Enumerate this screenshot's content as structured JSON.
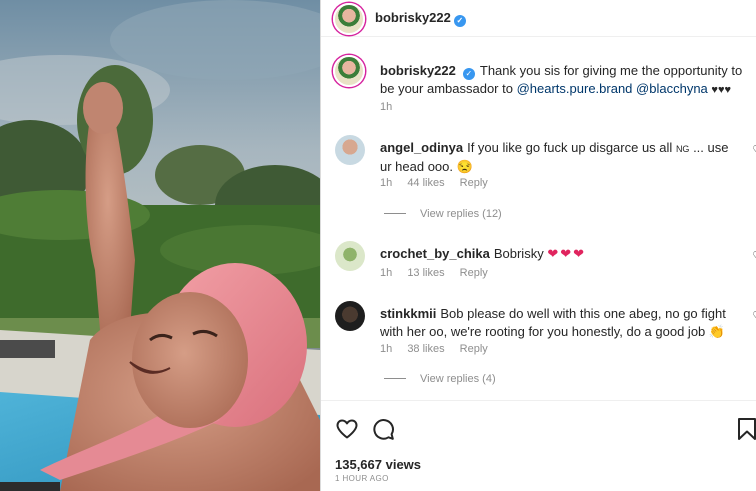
{
  "post": {
    "username": "bobrisky222",
    "verified": true,
    "caption_text": "Thank you sis for giving me the opportunity to be your ambassador to",
    "caption_mentions": [
      "@hearts.pure.brand",
      "@blacchyna"
    ],
    "caption_emoji": "♥♥♥",
    "caption_time": "1h",
    "views": "135,667 views",
    "posted": "1 HOUR AGO"
  },
  "comments": [
    {
      "username": "angel_odinya",
      "text": "If you like go fuck up disgarce us all",
      "flag": "NG",
      "text2": "... use ur head ooo.",
      "emoji": "😒",
      "time": "1h",
      "likes": "44 likes",
      "reply": "Reply",
      "view_replies": "View replies (12)"
    },
    {
      "username": "crochet_by_chika",
      "text": "Bobrisky",
      "emoji": "❤❤❤",
      "time": "1h",
      "likes": "13 likes",
      "reply": "Reply"
    },
    {
      "username": "stinkkmii",
      "text": "Bob please do well with this one abeg, no go fight with her oo, we're rooting for you honestly, do a good job",
      "emoji": "👏",
      "time": "1h",
      "likes": "38 likes",
      "reply": "Reply",
      "view_replies": "View replies (4)"
    }
  ],
  "icons": {
    "verified": "verified-badge-icon",
    "like": "heart-icon",
    "comment": "comment-icon",
    "save": "bookmark-icon"
  },
  "colors": {
    "link": "#00376b",
    "verified": "#3897f0",
    "muted": "#8e8e8e",
    "heart_red": "#e0245e"
  }
}
